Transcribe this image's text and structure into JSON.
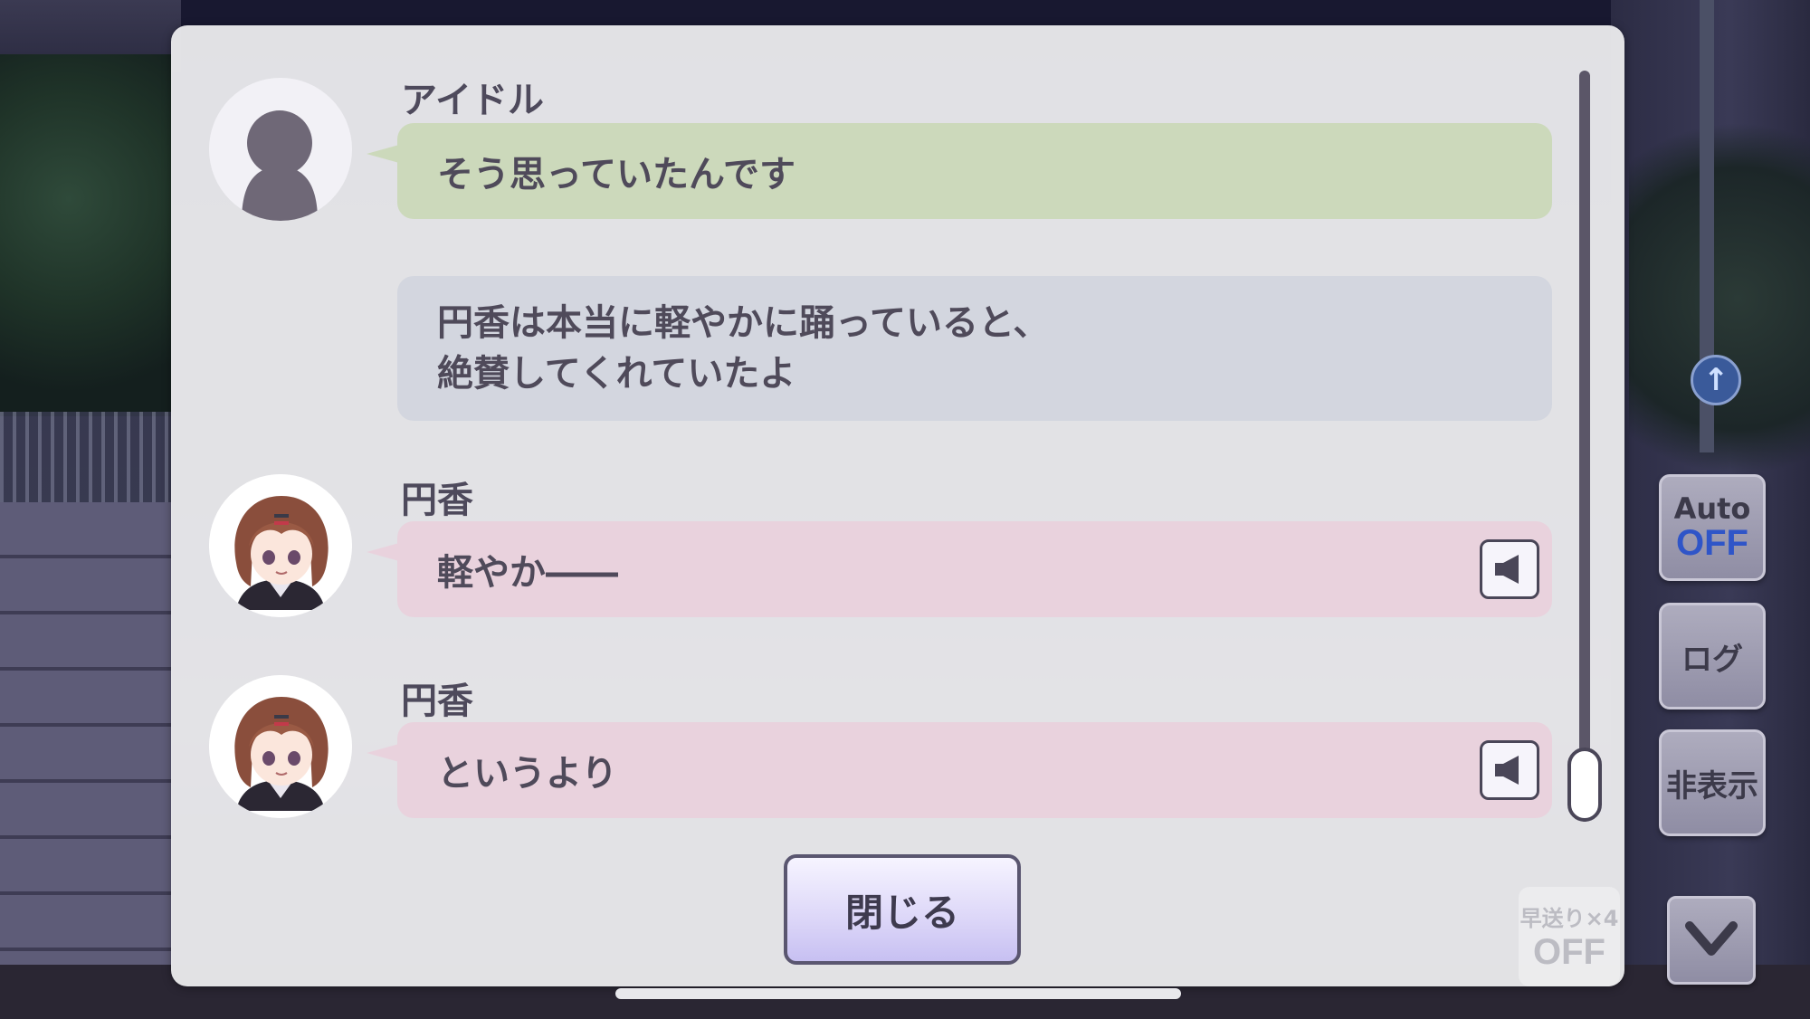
{
  "log_entries": [
    {
      "speaker": "アイドル",
      "lines": [
        "そう思っていたんです"
      ],
      "bubble": "green",
      "avatar": "silhouette-icon",
      "voice": false
    },
    {
      "speaker": "",
      "lines": [
        "円香は本当に軽やかに踊っていると、",
        "絶賛してくれていたよ"
      ],
      "bubble": "gray",
      "avatar": "",
      "voice": false
    },
    {
      "speaker": "円香",
      "lines": [
        "軽やか――"
      ],
      "bubble": "pink",
      "avatar": "madoka-avatar",
      "voice": true
    },
    {
      "speaker": "円香",
      "lines": [
        "というより"
      ],
      "bubble": "pink",
      "avatar": "madoka-avatar",
      "voice": true
    }
  ],
  "close_button": {
    "label": "閉じる"
  },
  "side_controls": {
    "auto": {
      "top": "Auto",
      "bottom": "OFF"
    },
    "log": "ログ",
    "hide": "非表示",
    "fast_forward": {
      "top": "早送り×4",
      "bottom": "OFF"
    }
  },
  "colors": {
    "bubble_green": "#ccd9bb",
    "bubble_gray": "#d3d6df",
    "bubble_pink": "#e9d2dd",
    "auto_off": "#2f55c8"
  }
}
